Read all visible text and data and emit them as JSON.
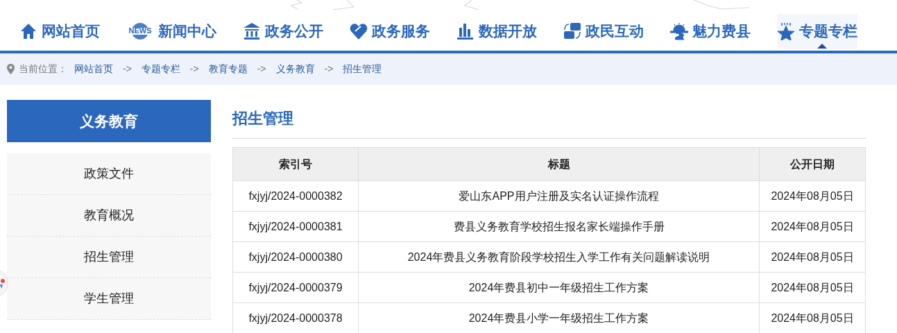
{
  "nav": [
    {
      "kind": "home",
      "label": "网站首页",
      "selected": false
    },
    {
      "kind": "news",
      "badge": "NEWS",
      "label": "新闻中心",
      "selected": false
    },
    {
      "kind": "bank",
      "label": "政务公开",
      "selected": false
    },
    {
      "kind": "heart",
      "label": "政务服务",
      "selected": false
    },
    {
      "kind": "chart",
      "label": "数据开放",
      "selected": false
    },
    {
      "kind": "swap",
      "label": "政民互动",
      "selected": false
    },
    {
      "kind": "sun",
      "label": "魅力费县",
      "selected": false
    },
    {
      "kind": "star",
      "label": "专题专栏",
      "selected": true
    }
  ],
  "breadcrumb": {
    "prefix": "当前位置：",
    "items": [
      "网站首页",
      "专题专栏",
      "教育专题",
      "义务教育",
      "招生管理"
    ],
    "separator": "->"
  },
  "sidebar": {
    "title": "义务教育",
    "items": [
      {
        "label": "政策文件",
        "selected": false
      },
      {
        "label": "教育概况",
        "selected": false
      },
      {
        "label": "招生管理",
        "selected": false
      },
      {
        "label": "学生管理",
        "selected": false
      }
    ]
  },
  "main": {
    "title": "招生管理",
    "table": {
      "columns": [
        "索引号",
        "标题",
        "公开日期"
      ],
      "rows": [
        [
          "fxjyj/2024-0000382",
          "爱山东APP用户注册及实名认证操作流程",
          "2024年08月05日"
        ],
        [
          "fxjyj/2024-0000381",
          "费县义务教育学校招生报名家长端操作手册",
          "2024年08月05日"
        ],
        [
          "fxjyj/2024-0000380",
          "2024年费县义务教育阶段学校招生入学工作有关问题解读说明",
          "2024年08月05日"
        ],
        [
          "fxjyj/2024-0000379",
          "2024年费县初中一年级招生工作方案",
          "2024年08月05日"
        ],
        [
          "fxjyj/2024-0000378",
          "2024年费县小学一年级招生工作方案",
          "2024年08月05日"
        ]
      ]
    }
  }
}
